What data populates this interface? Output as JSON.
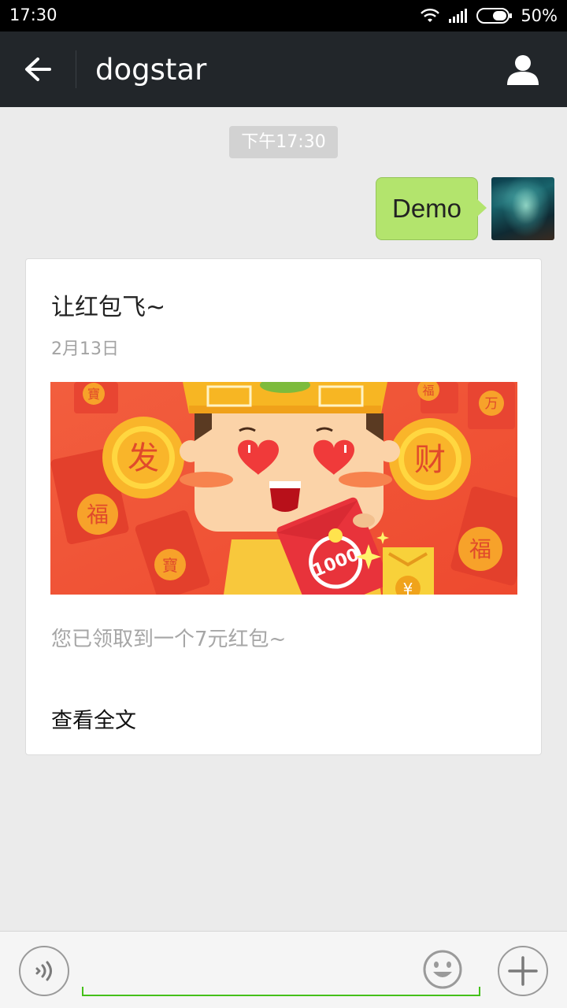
{
  "status_bar": {
    "time": "17:30",
    "battery": "50%"
  },
  "header": {
    "title": "dogstar"
  },
  "chat": {
    "timestamp": "下午17:30",
    "outgoing_message": "Demo"
  },
  "card": {
    "title": "让红包飞~",
    "date": "2月13日",
    "banner_chars": {
      "left_coin": "发",
      "right_coin": "财",
      "fu_left": "福",
      "fu_right": "福",
      "bao": "寶",
      "wan": "万",
      "fu_top": "福",
      "envelope": "1000",
      "yen": "¥"
    },
    "description": "您已领取到一个7元红包~",
    "read_all": "查看全文"
  },
  "input_bar": {
    "text_value": ""
  },
  "icons": {
    "wifi": "wifi-icon",
    "signal": "signal-icon",
    "battery": "battery-icon",
    "back": "back-arrow-icon",
    "profile": "profile-icon",
    "voice": "voice-icon",
    "emoji": "emoji-icon",
    "plus": "plus-icon"
  },
  "colors": {
    "header_bg": "#22262a",
    "bubble": "#b3e46d",
    "accent": "#45c01a",
    "banner": "#f15a3c"
  }
}
